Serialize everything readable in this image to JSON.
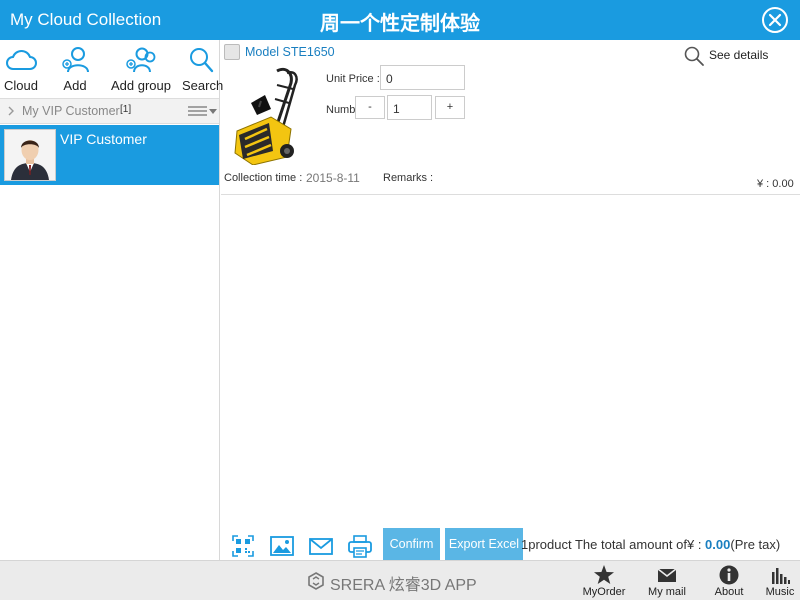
{
  "header": {
    "app_title": "My Cloud Collection",
    "center_title": "周一个性定制体验",
    "close_icon": "close-circle-icon"
  },
  "sidebar": {
    "tools": [
      {
        "label": "Cloud",
        "icon": "cloud-icon"
      },
      {
        "label": "Add user",
        "icon": "add-user-icon"
      },
      {
        "label": "Add group",
        "icon": "add-group-icon"
      },
      {
        "label": "Search",
        "icon": "search-icon"
      }
    ],
    "group": {
      "name": "My VIP Customer",
      "count": "[1]"
    },
    "customers": [
      {
        "name": "VIP Customer",
        "selected": true
      }
    ]
  },
  "product": {
    "model": "Model STE1650",
    "see_details": "See details",
    "unit_price_label": "Unit Price :",
    "unit_price_value": "0",
    "number_label": "Number :",
    "minus": "-",
    "number_value": "1",
    "plus": "+",
    "collection_time_label": "Collection time :",
    "collection_time_value": "2015-8-11",
    "remarks_label": "Remarks :",
    "line_total": "¥ : 0.00"
  },
  "action_bar": {
    "icons": [
      "qr-code-icon",
      "image-icon",
      "mail-icon",
      "print-icon"
    ],
    "confirm_label": "Confirm",
    "export_label": "Export Excel",
    "summary_prefix": "1product The total amount of¥ : ",
    "summary_amount": "0.00",
    "summary_suffix": "(Pre tax)"
  },
  "footer": {
    "brand": "SRERA 炫睿3D APP",
    "nav": [
      {
        "label": "MyOrder",
        "icon": "star-icon"
      },
      {
        "label": "My mail",
        "icon": "mail-icon"
      },
      {
        "label": "About",
        "icon": "info-icon"
      },
      {
        "label": "Music",
        "icon": "music-bars-icon"
      }
    ]
  },
  "colors": {
    "accent": "#1a9be0",
    "button": "#5ab6e5",
    "link": "#1a7fc0"
  }
}
